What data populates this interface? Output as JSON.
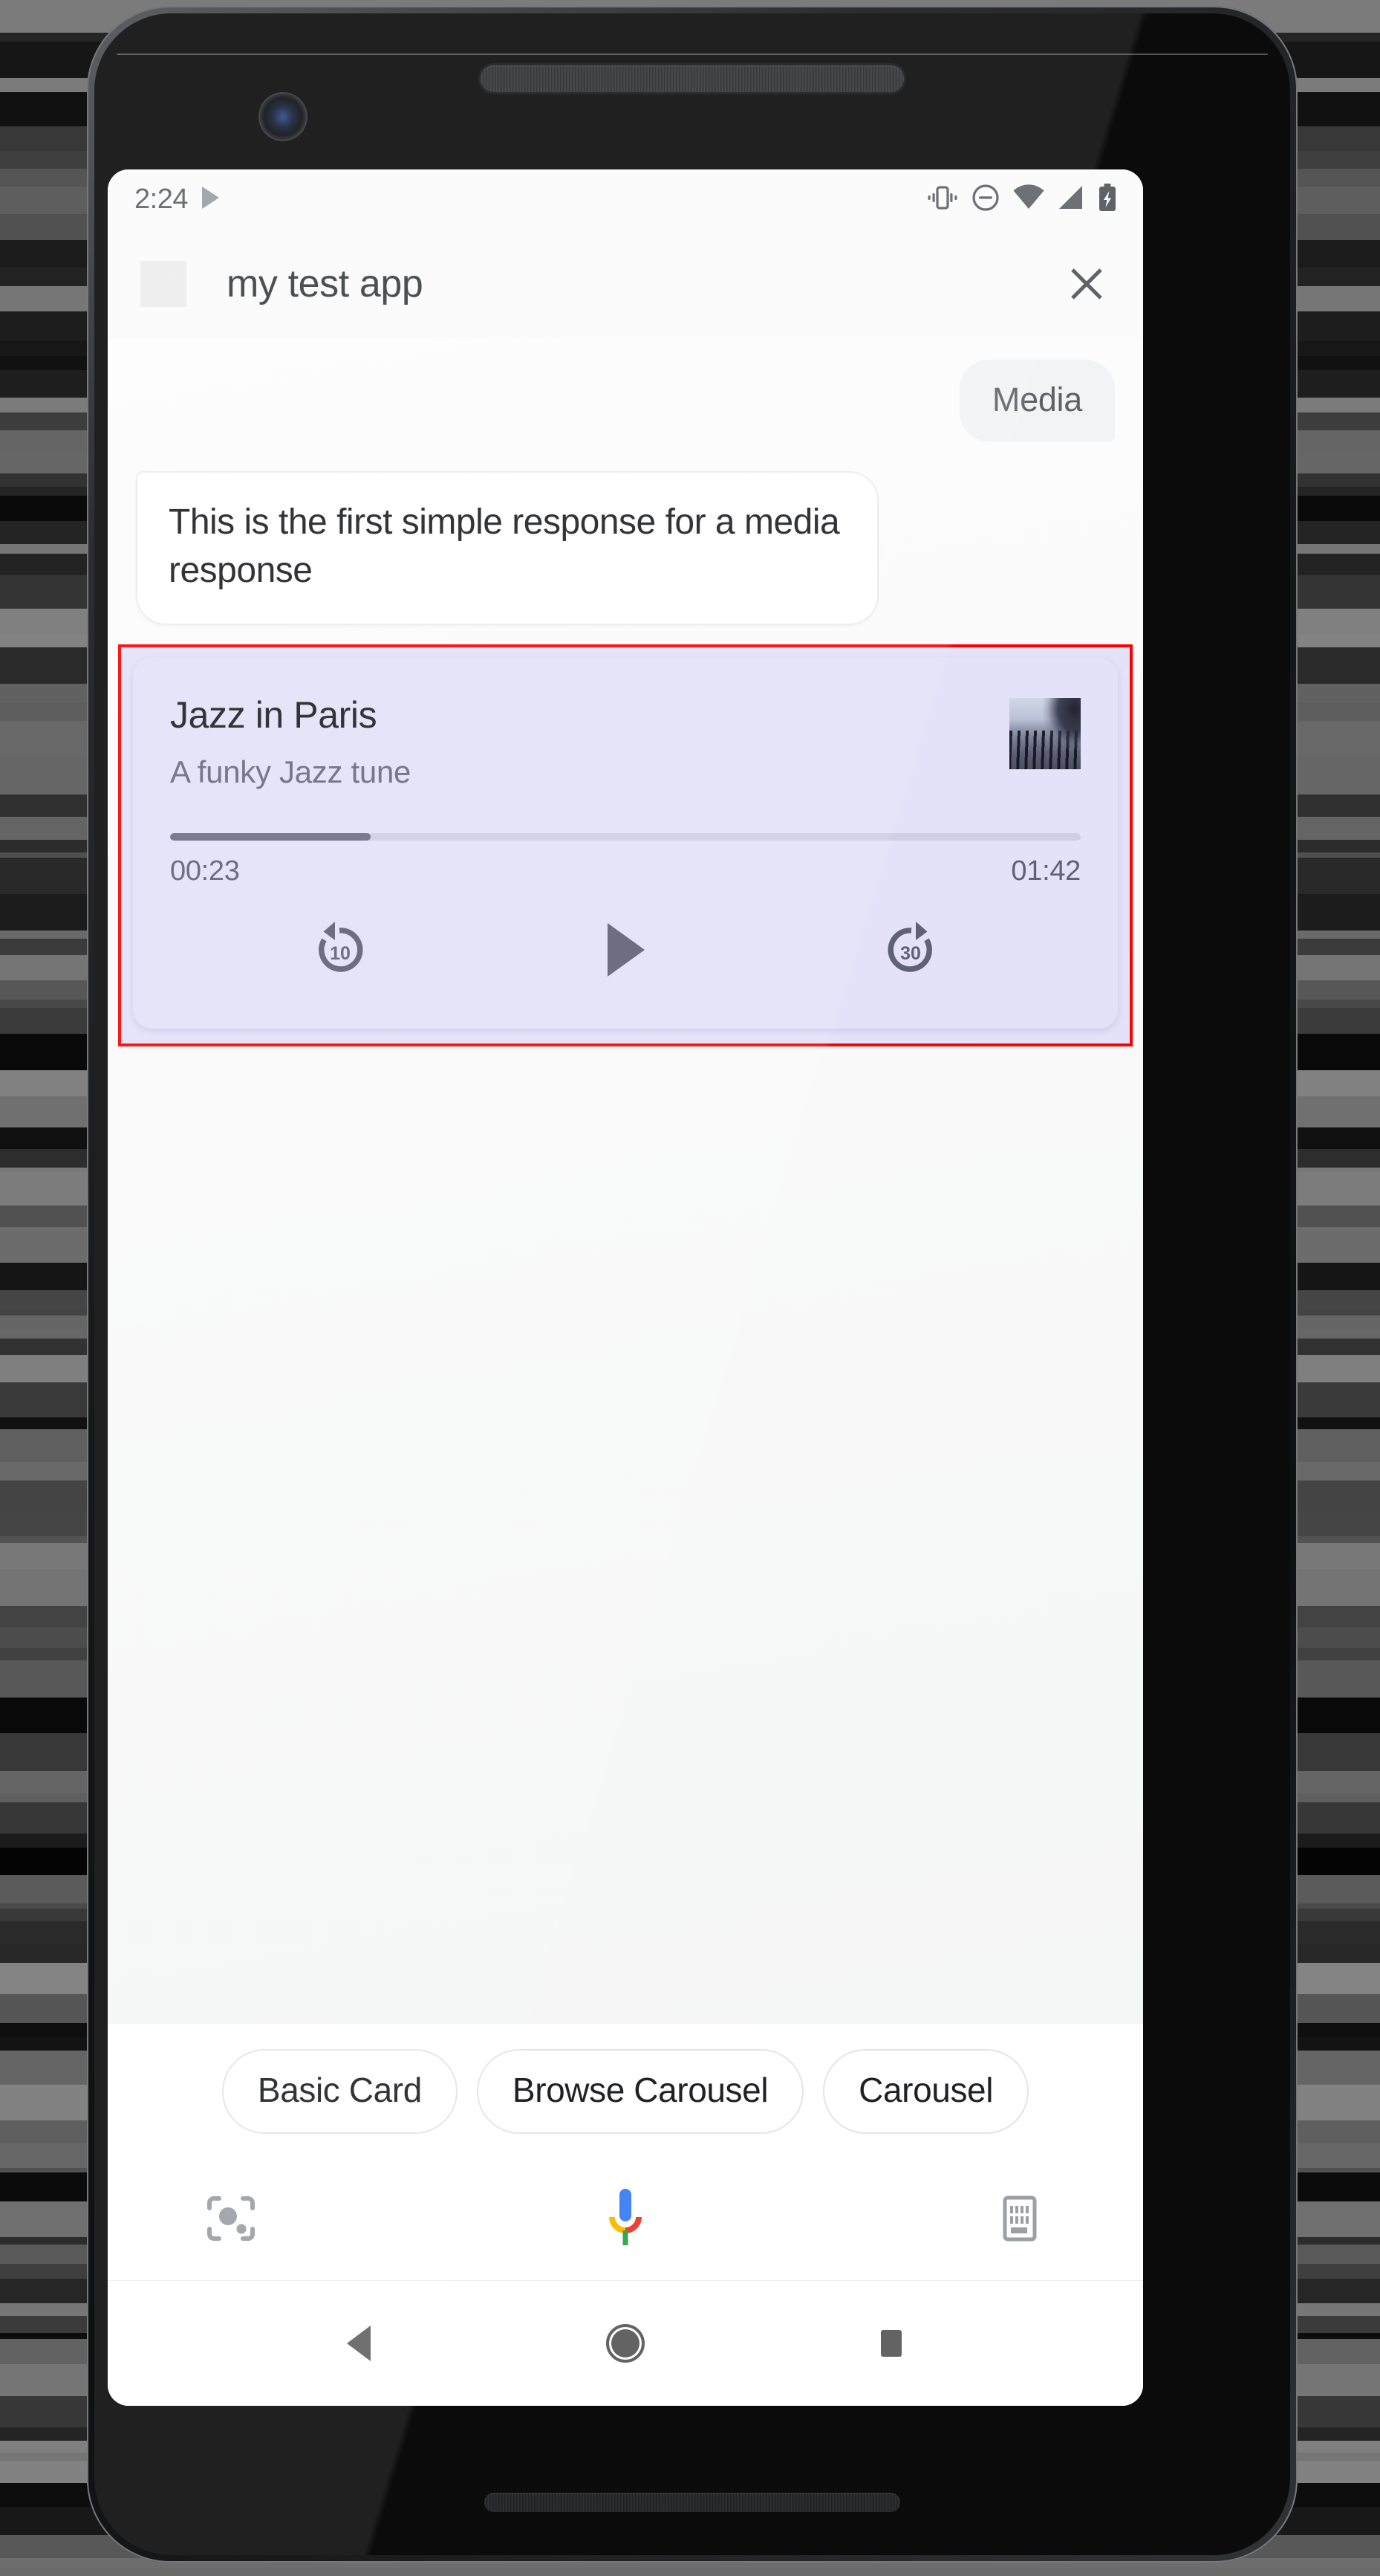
{
  "status_bar": {
    "time": "2:24",
    "icons": [
      "play-arrow-icon",
      "vibrate-icon",
      "do-not-disturb-icon",
      "wifi-icon",
      "cell-signal-icon",
      "battery-charging-icon"
    ]
  },
  "header": {
    "app_title": "my test app",
    "app_icon": "app-placeholder-icon",
    "close_icon": "close-icon"
  },
  "conversation": {
    "user_message": "Media",
    "assistant_response": "This is the first simple response for a media response"
  },
  "media_card": {
    "title": "Jazz in Paris",
    "subtitle": "A funky Jazz tune",
    "thumbnail": "album-art-fence-by-water",
    "elapsed_time": "00:23",
    "total_time": "01:42",
    "progress_percent": 22,
    "controls": {
      "rewind_label": "10",
      "rewind_icon": "replay-10-icon",
      "play_icon": "play-icon",
      "forward_label": "30",
      "forward_icon": "forward-30-icon"
    },
    "colors": {
      "card_background": "#E4E2F8",
      "progress_fill": "#6D6D86",
      "progress_track": "#CDD0E2",
      "control_icon": "#5F6175",
      "annotation_border": "#FF0000"
    }
  },
  "suggestion_chips": [
    {
      "label": "Basic Card"
    },
    {
      "label": "Browse Carousel"
    },
    {
      "label": "Carousel"
    }
  ],
  "input_bar": {
    "lens_icon": "google-lens-icon",
    "mic_icon": "assistant-mic-icon",
    "keyboard_icon": "keyboard-icon"
  },
  "nav_bar": {
    "back_icon": "back-triangle-icon",
    "home_icon": "home-circle-icon",
    "recents_icon": "recents-square-icon"
  }
}
